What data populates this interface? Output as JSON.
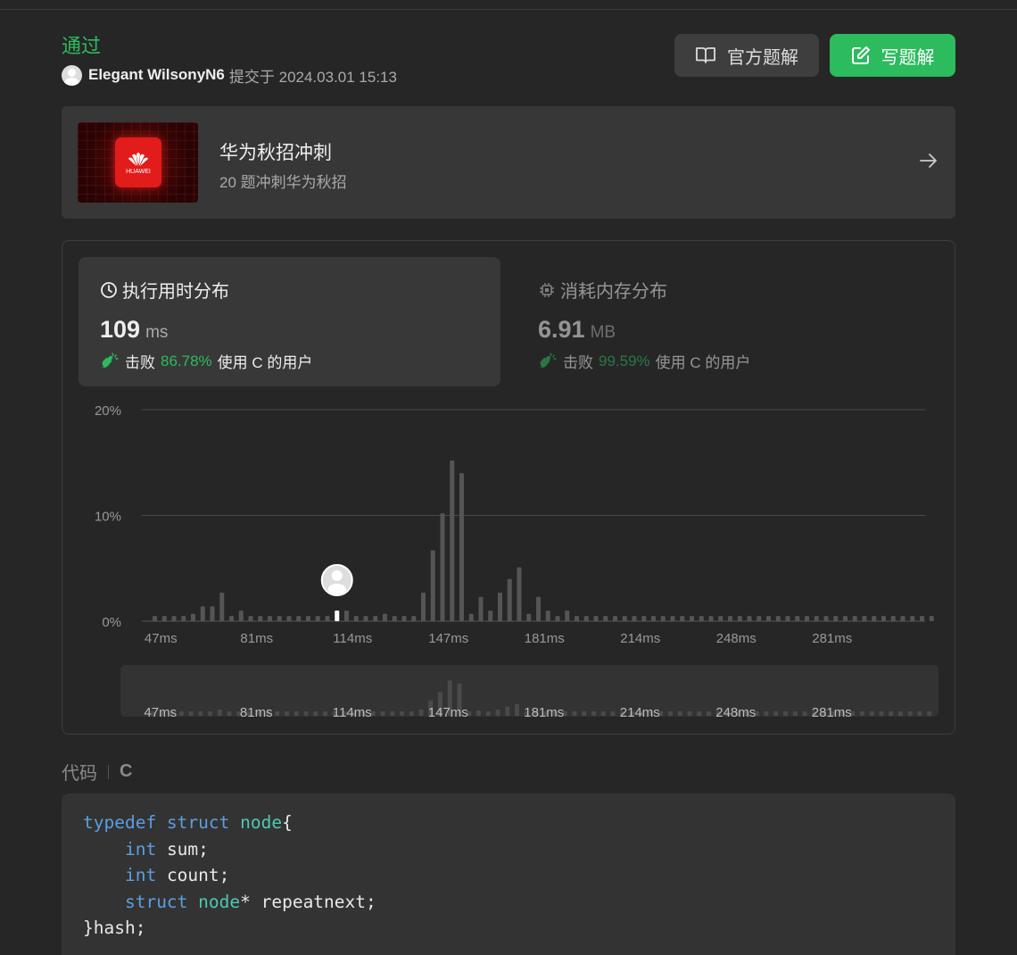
{
  "header": {
    "status": "通过",
    "username": "Elegant WilsonyN6",
    "submitted_text": "提交于 2024.03.01 15:13",
    "official_solution_label": "官方题解",
    "write_solution_label": "写题解"
  },
  "card": {
    "title": "华为秋招冲刺",
    "subtitle": "20 题冲刺华为秋招",
    "logo_text": "HUAWEI"
  },
  "runtime_tab": {
    "label": "执行用时分布",
    "value": "109",
    "unit": "ms",
    "beat_label": "击败",
    "beat_pct": "86.78%",
    "beat_suffix": "使用 C 的用户"
  },
  "memory_tab": {
    "label": "消耗内存分布",
    "value": "6.91",
    "unit": "MB",
    "beat_label": "击败",
    "beat_pct": "99.59%",
    "beat_suffix": "使用 C 的用户"
  },
  "code_section": {
    "label": "代码",
    "language": "C"
  },
  "code_lines": [
    [
      {
        "t": "typedef ",
        "c": "kw"
      },
      {
        "t": "struct ",
        "c": "kw"
      },
      {
        "t": "node",
        "c": "ty"
      },
      {
        "t": "{",
        "c": ""
      }
    ],
    [
      {
        "t": "    ",
        "c": ""
      },
      {
        "t": "int",
        "c": "kw"
      },
      {
        "t": " sum;",
        "c": ""
      }
    ],
    [
      {
        "t": "    ",
        "c": ""
      },
      {
        "t": "int",
        "c": "kw"
      },
      {
        "t": " count;",
        "c": ""
      }
    ],
    [
      {
        "t": "    ",
        "c": ""
      },
      {
        "t": "struct ",
        "c": "kw"
      },
      {
        "t": "node",
        "c": "ty"
      },
      {
        "t": "* repeatnext;",
        "c": ""
      }
    ],
    [
      {
        "t": "}hash;",
        "c": ""
      }
    ]
  ],
  "chart_data": {
    "type": "bar",
    "yticks": [
      "20%",
      "10%",
      "0%"
    ],
    "ylim": [
      0,
      20
    ],
    "xticks": [
      {
        "label": "47ms",
        "index": 1
      },
      {
        "label": "81ms",
        "index": 11
      },
      {
        "label": "114ms",
        "index": 21
      },
      {
        "label": "147ms",
        "index": 31
      },
      {
        "label": "181ms",
        "index": 41
      },
      {
        "label": "214ms",
        "index": 51
      },
      {
        "label": "248ms",
        "index": 61
      },
      {
        "label": "281ms",
        "index": 71
      }
    ],
    "highlight_index": 19,
    "values": [
      0.5,
      0.5,
      0.5,
      0.5,
      0.7,
      1.4,
      1.4,
      2.7,
      0.5,
      1,
      0.5,
      0.5,
      0.5,
      0.5,
      0.5,
      0.5,
      0.5,
      0.5,
      0.5,
      1,
      1,
      0.5,
      0.5,
      0.5,
      0.7,
      0.5,
      0.5,
      0.5,
      2.7,
      6.7,
      10.2,
      15.2,
      14,
      0.7,
      2.3,
      1,
      2.7,
      4,
      5.1,
      0.7,
      2.3,
      1,
      0.5,
      1,
      0.5,
      0.5,
      0.5,
      0.5,
      0.5,
      0.5,
      0.5,
      0.5,
      0.5,
      0.5,
      0.5,
      0.5,
      0.5,
      0.5,
      0.5,
      0.5,
      0.5,
      0.5,
      0.5,
      0.5,
      0.5,
      0.5,
      0.5,
      0.5,
      0.5,
      0.5,
      0.5,
      0.5,
      0.5,
      0.5,
      0.5,
      0.5,
      0.5,
      0.5,
      0.5,
      0.5,
      0.5,
      0.5
    ],
    "colors": {
      "bar": "#555555",
      "highlight": "#ffffff",
      "grid": "#4a4a4a",
      "minibar": "#4a4a4a"
    }
  }
}
